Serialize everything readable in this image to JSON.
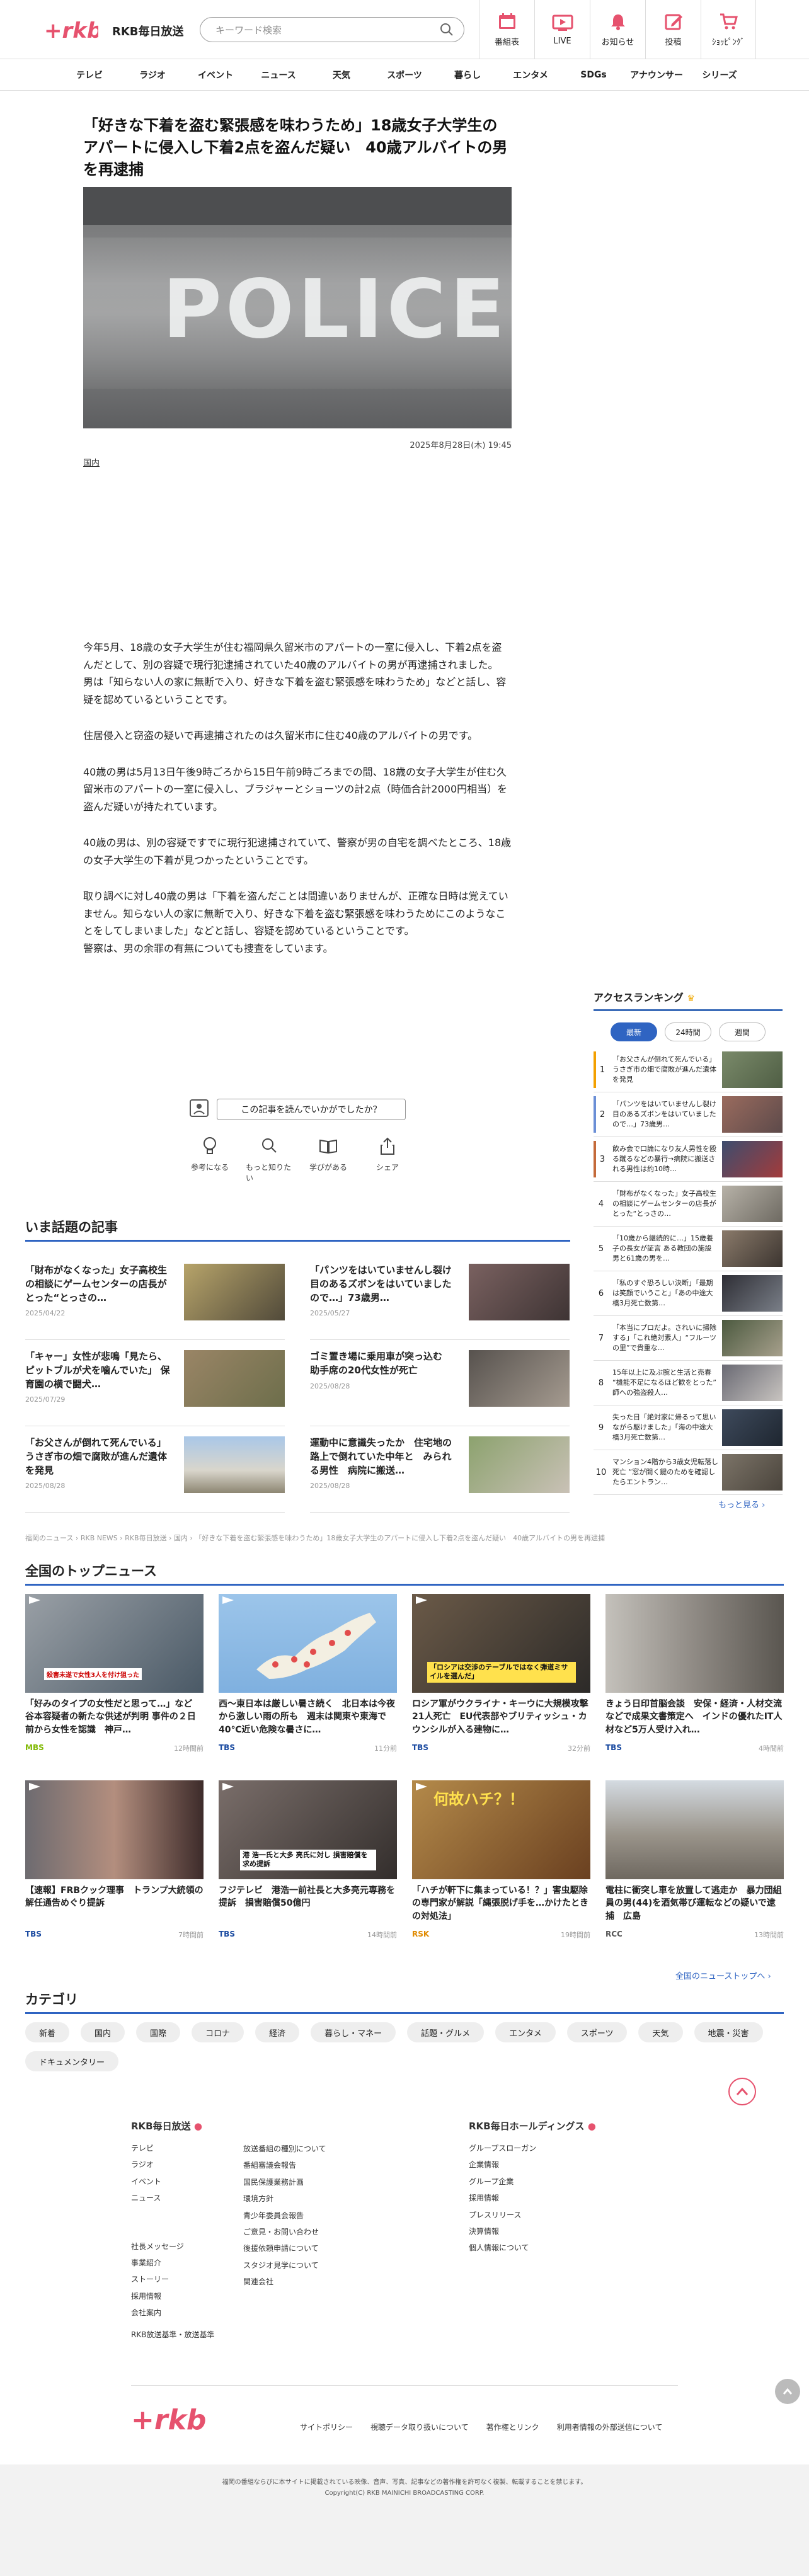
{
  "header": {
    "brand": "RKB毎日放送",
    "search_placeholder": "キーワード検索",
    "nav": [
      {
        "label": "番組表",
        "icon": "calendar-icon"
      },
      {
        "label": "LIVE",
        "icon": "live-tv-icon"
      },
      {
        "label": "お知らせ",
        "icon": "bell-icon"
      },
      {
        "label": "投稿",
        "icon": "pen-icon"
      },
      {
        "label": "ｼｮｯﾋﾟﾝｸﾞ",
        "icon": "cart-icon"
      }
    ],
    "accent": "#e6526e"
  },
  "categories_bar": [
    "テレビ",
    "ラジオ",
    "イベント",
    "ニュース",
    "天気",
    "スポーツ",
    "暮らし",
    "エンタメ",
    "SDGs",
    "アナウンサー",
    "シリーズ"
  ],
  "article": {
    "title": "「好きな下着を盗む緊張感を味わうため」18歳女子大学生のアパートに侵入し下着2点を盗んだ疑い　40歳アルバイトの男を再逮捕",
    "photo_text": "POLICE",
    "date": "2025年8月28日(木) 19:45",
    "tag": "国内",
    "p1": "今年5月、18歳の女子大学生が住む福岡県久留米市のアパートの一室に侵入し、下着2点を盗んだとして、別の容疑で現行犯逮捕されていた40歳のアルバイトの男が再逮捕されました。",
    "p1b": "男は「知らない人の家に無断で入り、好きな下着を盗む緊張感を味わうため」などと話し、容疑を認めているということです。",
    "p2": "住居侵入と窃盗の疑いで再逮捕されたのは久留米市に住む40歳のアルバイトの男です。",
    "p3": "40歳の男は5月13日午後9時ごろから15日午前9時ごろまでの間、18歳の女子大学生が住む久留米市のアパートの一室に侵入し、ブラジャーとショーツの計2点（時価合計2000円相当）を盗んだ疑いが持たれています。",
    "p4": "40歳の男は、別の容疑ですでに現行犯逮捕されていて、警察が男の自宅を調べたところ、18歳の女子大学生の下着が見つかったということです。",
    "p5": "取り調べに対し40歳の男は「下着を盗んだことは間違いありませんが、正確な日時は覚えていません。知らない人の家に無断で入り、好きな下着を盗む緊張感を味わうためにこのようなことをしてしまいました」などと話し、容疑を認めているということです。",
    "p5b": "警察は、男の余罪の有無についても捜査をしています。",
    "feedback_prompt": "この記事を読んでいかがでしたか？",
    "reactions": [
      {
        "label": "参考になる",
        "icon": "lightbulb-icon"
      },
      {
        "label": "もっと知りたい",
        "icon": "magnifier-icon"
      },
      {
        "label": "学びがある",
        "icon": "book-icon"
      },
      {
        "label": "シェア",
        "icon": "share-icon"
      }
    ]
  },
  "ranking": {
    "heading": "アクセスランキング",
    "tabs": [
      "最新",
      "24時間",
      "週間"
    ],
    "items": [
      {
        "n": "1",
        "text": "「お父さんが倒れて死んでいる」うさぎ市の畑で腐敗が進んだ遺体を発見"
      },
      {
        "n": "2",
        "text": "「パンツをはいていませんし裂け目のあるズボンをはいていましたので…」73歳男…"
      },
      {
        "n": "3",
        "text": "飲み会で口論になり友人男性を殴る蹴るなどの暴行→病院に搬送される男性は約10時…"
      },
      {
        "n": "4",
        "text": "「財布がなくなった」女子高校生の相談にゲームセンターの店長がとった“とっさの…"
      },
      {
        "n": "5",
        "text": "「10歳から継続的に…」15歳養子の長女が証言 ある教団の施設　男と61歳の男を…"
      },
      {
        "n": "6",
        "text": "「私のすぐ恐ろしい決断」「最期は笑顔でいうこと」「あの中途大橋3月死亡数第…"
      },
      {
        "n": "7",
        "text": "「本当にプロだよ。されいに掃除する」「これ絶対素人」“フルーツの里”で貴重な…"
      },
      {
        "n": "8",
        "text": "15年以上に及ぶ腕と生活と売春 “機能不足になるほど歓をとった”　師への強盗殺人…"
      },
      {
        "n": "9",
        "text": "失った日「絶対家に帰るって思いながら駆けました」「海の中途大橋3月死亡数第…"
      },
      {
        "n": "10",
        "text": "マンション4階から3歳女児転落し死亡 “窓が開く鍵のためを確認したらエントラン…"
      }
    ],
    "more": "もっと見る ›"
  },
  "hot": {
    "heading": "いま話題の記事",
    "items": [
      {
        "text": "「財布がなくなった」女子高校生の相談にゲームセンターの店長がとった“とっさの…",
        "date": "2025/04/22"
      },
      {
        "text": "「パンツをはいていませんし裂け目のあるズボンをはいていましたので…」73歳男…",
        "date": "2025/05/27"
      },
      {
        "text": "「キャー」女性が悲鳴「見たら、ピットブルが犬を噛んでいた」 保育園の横で闘犬…",
        "date": "2025/07/29"
      },
      {
        "text": "ゴミ置き場に乗用車が突っ込む　助手席の20代女性が死亡",
        "date": "2025/08/28"
      },
      {
        "text": "「お父さんが倒れて死んでいる」うさぎ市の畑で腐敗が進んだ遺体を発見",
        "date": "2025/08/28"
      },
      {
        "text": "運動中に意識失ったか　住宅地の路上で倒れていた中年と　みられる男性　病院に搬送…",
        "date": "2025/08/28"
      }
    ]
  },
  "breadcrumb": "福岡のニュース › RKB NEWS › RKB毎日放送 › 国内 › 「好きな下着を盗む緊張感を味わうため」18歳女子大学生のアパートに侵入し下着2点を盗んだ疑い　40歳アルバイトの男を再逮捕",
  "topnews": {
    "heading": "全国のトップニュース",
    "items": [
      {
        "text": "「好みのタイプの女性だと思って…」など 谷本容疑者の新たな供述が判明 事件の２日前から女性を認識　神戸…",
        "src": "MBS",
        "time": "12時間前",
        "srcColor": "#7fb800"
      },
      {
        "text": "西〜東日本は厳しい暑さ続く　北日本は今夜から激しい雨の所も　週末は関東や東海で40℃近い危険な暑さに…",
        "src": "TBS",
        "time": "11分前",
        "srcColor": "#1a4aa0"
      },
      {
        "text": "ロシア軍がウクライナ・キーウに大規模攻撃 21人死亡　EU代表部やブリティッシュ・カウンシルが入る建物に…",
        "src": "TBS",
        "time": "32分前",
        "srcColor": "#1a4aa0"
      },
      {
        "text": "きょう日印首脳会談　安保・経済・人材交流などで成果文書策定へ　インドの優れたIT人材など5万人受け入れ…",
        "src": "TBS",
        "time": "4時間前",
        "srcColor": "#1a4aa0"
      },
      {
        "text": "【速報】FRBクック理事　トランプ大統領の解任通告めぐり提訴",
        "src": "TBS",
        "time": "7時間前",
        "srcColor": "#1a4aa0"
      },
      {
        "text": "フジテレビ　港浩一前社長と大多亮元専務を提訴　損害賠償50億円",
        "src": "TBS",
        "time": "14時間前",
        "srcColor": "#1a4aa0"
      },
      {
        "text": "「ハチが軒下に集まっている！？」害虫駆除の専門家が解説「縄張脱げ手を…かけたときの対処法」",
        "src": "RSK",
        "time": "19時間前",
        "srcColor": "#e08a00"
      },
      {
        "text": "電柱に衝突し車を放置して逃走か　暴力団組員の男(44)を酒気帯び運転などの疑いで逮捕　広島",
        "src": "RCC",
        "time": "13時間前",
        "srcColor": "#555"
      }
    ],
    "photo_captions": [
      "殺害未遂で女性3人を付け狙った",
      "",
      "「ロシアは交渉のテーブルではなく弾道ミサイルを選んだ」",
      "",
      "",
      "港 浩一氏と大多 亮氏に対し 損害賠償を求め提訴",
      "何故ハチ？！",
      ""
    ],
    "more": "全国のニューストップへ ›"
  },
  "category_section": {
    "heading": "カテゴリ",
    "items": [
      "新着",
      "国内",
      "国際",
      "コロナ",
      "経済",
      "暮らし・マネー",
      "話題・グルメ",
      "エンタメ",
      "スポーツ",
      "天気",
      "地震・災害",
      "ドキュメンタリー"
    ]
  },
  "footer": {
    "col1_head": "RKB毎日放送",
    "col1a": [
      "テレビ",
      "ラジオ",
      "イベント",
      "ニュース"
    ],
    "col1b": [
      "社長メッセージ",
      "事業紹介",
      "ストーリー",
      "採用情報",
      "会社案内"
    ],
    "col1c": [
      "RKB放送基準・放送基準"
    ],
    "col2": [
      "放送番組の種別について",
      "番組審議会報告",
      "国民保護業務計画",
      "環境方針",
      "青少年委員会報告",
      "ご意見・お問い合わせ",
      "後援依頼申請について",
      "スタジオ見学について",
      "関連会社"
    ],
    "col3_head": "RKB毎日ホールディングス",
    "col3": [
      "グループスローガン",
      "企業情報",
      "グループ企業",
      "採用情報",
      "プレスリリース",
      "決算情報",
      "個人情報について"
    ],
    "links": [
      "サイトポリシー",
      "視聴データ取り扱いについて",
      "著作権とリンク",
      "利用者情報の外部送信について"
    ],
    "notice": "福岡の番組ならびに本サイトに掲載されている映像、音声、写真、記事などの著作権を許可なく複製、転載することを禁じます。",
    "copyright": "Copyright(C) RKB MAINICHI BROADCASTING CORP."
  }
}
